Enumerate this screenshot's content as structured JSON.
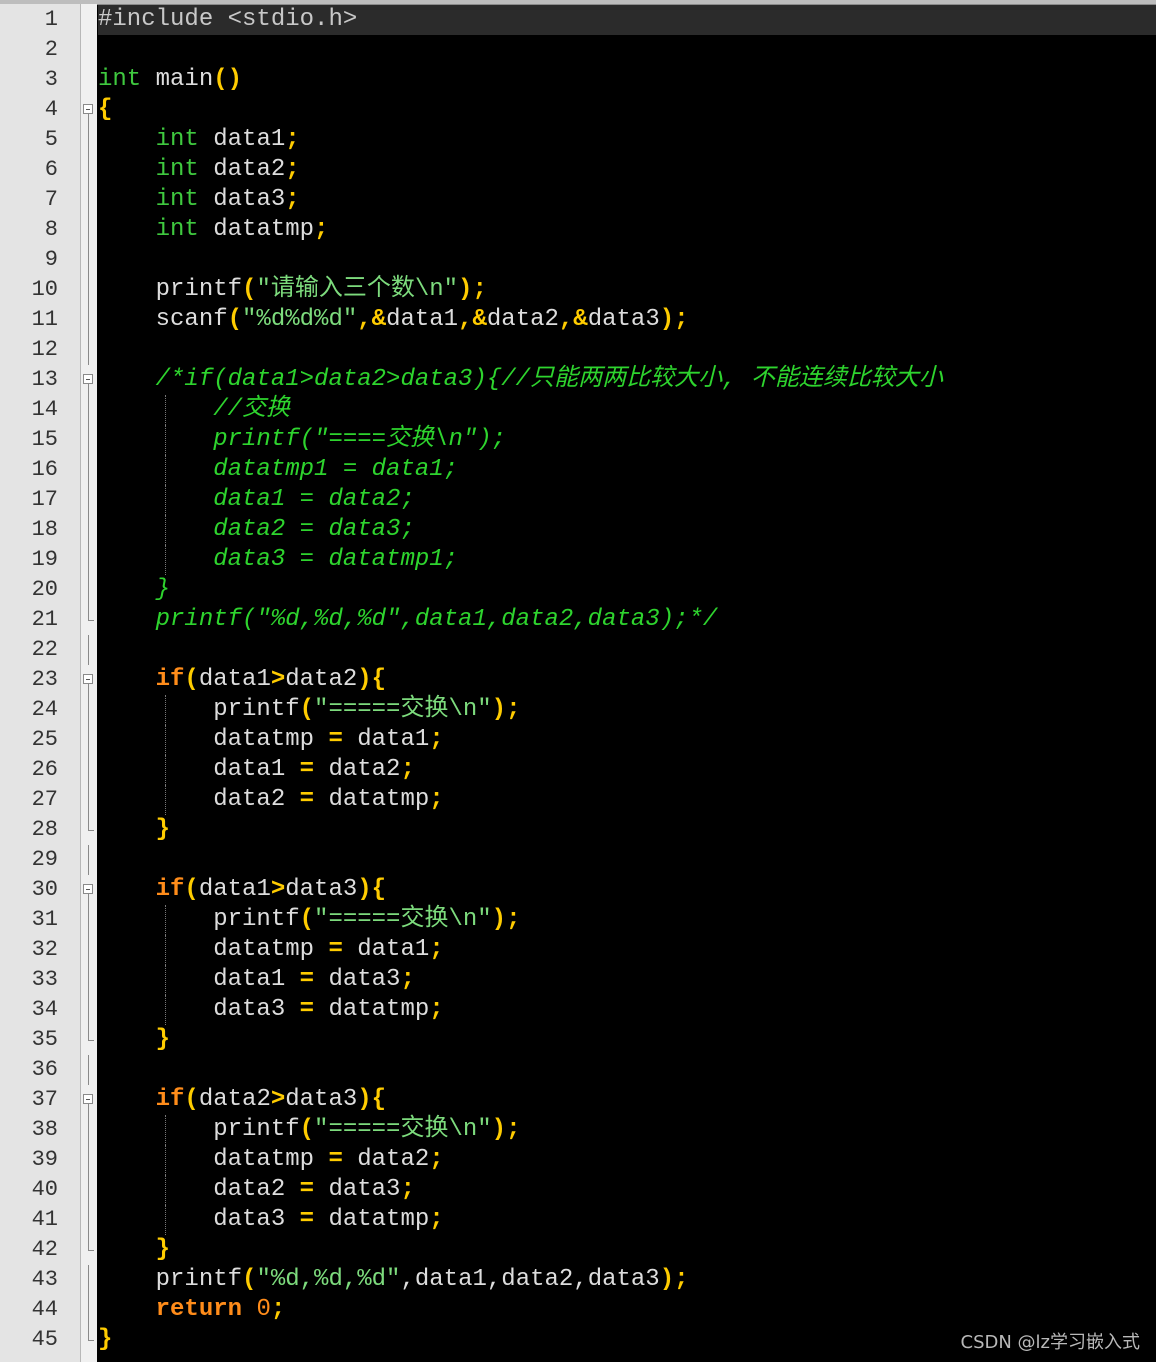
{
  "editor": {
    "watermark": "CSDN @lz学习嵌入式",
    "current_line": 1,
    "lines": [
      {
        "n": "1",
        "fold": "none",
        "tokens": [
          [
            "pre",
            "#include <stdio.h>"
          ]
        ]
      },
      {
        "n": "2",
        "fold": "none",
        "tokens": []
      },
      {
        "n": "3",
        "fold": "none",
        "tokens": [
          [
            "type",
            "int"
          ],
          [
            "plain",
            " main"
          ],
          [
            "op",
            "()"
          ]
        ]
      },
      {
        "n": "4",
        "fold": "box",
        "tokens": [
          [
            "op",
            "{"
          ]
        ]
      },
      {
        "n": "5",
        "fold": "line",
        "tokens": [
          [
            "plain",
            "    "
          ],
          [
            "type",
            "int"
          ],
          [
            "plain",
            " data1"
          ],
          [
            "op",
            ";"
          ]
        ]
      },
      {
        "n": "6",
        "fold": "line",
        "tokens": [
          [
            "plain",
            "    "
          ],
          [
            "type",
            "int"
          ],
          [
            "plain",
            " data2"
          ],
          [
            "op",
            ";"
          ]
        ]
      },
      {
        "n": "7",
        "fold": "line",
        "tokens": [
          [
            "plain",
            "    "
          ],
          [
            "type",
            "int"
          ],
          [
            "plain",
            " data3"
          ],
          [
            "op",
            ";"
          ]
        ]
      },
      {
        "n": "8",
        "fold": "line",
        "tokens": [
          [
            "plain",
            "    "
          ],
          [
            "type",
            "int"
          ],
          [
            "plain",
            " datatmp"
          ],
          [
            "op",
            ";"
          ]
        ]
      },
      {
        "n": "9",
        "fold": "line",
        "tokens": []
      },
      {
        "n": "10",
        "fold": "line",
        "tokens": [
          [
            "plain",
            "    printf"
          ],
          [
            "op",
            "("
          ],
          [
            "str",
            "\"请输入三个数\\n\""
          ],
          [
            "op",
            ");"
          ]
        ]
      },
      {
        "n": "11",
        "fold": "line",
        "tokens": [
          [
            "plain",
            "    scanf"
          ],
          [
            "op",
            "("
          ],
          [
            "str",
            "\"%d%d%d\""
          ],
          [
            "op",
            ",&"
          ],
          [
            "plain",
            "data1"
          ],
          [
            "op",
            ",&"
          ],
          [
            "plain",
            "data2"
          ],
          [
            "op",
            ",&"
          ],
          [
            "plain",
            "data3"
          ],
          [
            "op",
            ");"
          ]
        ]
      },
      {
        "n": "12",
        "fold": "line",
        "tokens": []
      },
      {
        "n": "13",
        "fold": "box",
        "tokens": [
          [
            "plain",
            "    "
          ],
          [
            "cmt",
            "/*if(data1>data2>data3){//只能两两比较大小, 不能连续比较大小"
          ]
        ]
      },
      {
        "n": "14",
        "fold": "line",
        "guide": true,
        "tokens": [
          [
            "plain",
            "        "
          ],
          [
            "cmt",
            "//交换"
          ]
        ]
      },
      {
        "n": "15",
        "fold": "line",
        "guide": true,
        "tokens": [
          [
            "plain",
            "        "
          ],
          [
            "cmt",
            "printf(\"====交换\\n\");"
          ]
        ]
      },
      {
        "n": "16",
        "fold": "line",
        "guide": true,
        "tokens": [
          [
            "plain",
            "        "
          ],
          [
            "cmt",
            "datatmp1 = data1;"
          ]
        ]
      },
      {
        "n": "17",
        "fold": "line",
        "guide": true,
        "tokens": [
          [
            "plain",
            "        "
          ],
          [
            "cmt",
            "data1 = data2;"
          ]
        ]
      },
      {
        "n": "18",
        "fold": "line",
        "guide": true,
        "tokens": [
          [
            "plain",
            "        "
          ],
          [
            "cmt",
            "data2 = data3;"
          ]
        ]
      },
      {
        "n": "19",
        "fold": "line",
        "guide": true,
        "tokens": [
          [
            "plain",
            "        "
          ],
          [
            "cmt",
            "data3 = datatmp1;"
          ]
        ]
      },
      {
        "n": "20",
        "fold": "line",
        "tokens": [
          [
            "plain",
            "    "
          ],
          [
            "cmt",
            "}"
          ]
        ]
      },
      {
        "n": "21",
        "fold": "end",
        "tokens": [
          [
            "plain",
            "    "
          ],
          [
            "cmt",
            "printf(\"%d,%d,%d\",data1,data2,data3);*/"
          ]
        ]
      },
      {
        "n": "22",
        "fold": "line",
        "tokens": []
      },
      {
        "n": "23",
        "fold": "box",
        "tokens": [
          [
            "plain",
            "    "
          ],
          [
            "kw",
            "if"
          ],
          [
            "op",
            "("
          ],
          [
            "plain",
            "data1"
          ],
          [
            "op",
            ">"
          ],
          [
            "plain",
            "data2"
          ],
          [
            "op",
            "){"
          ]
        ]
      },
      {
        "n": "24",
        "fold": "line",
        "guide": true,
        "tokens": [
          [
            "plain",
            "        printf"
          ],
          [
            "op",
            "("
          ],
          [
            "str",
            "\"=====交换\\n\""
          ],
          [
            "op",
            ");"
          ]
        ]
      },
      {
        "n": "25",
        "fold": "line",
        "guide": true,
        "tokens": [
          [
            "plain",
            "        datatmp "
          ],
          [
            "op",
            "="
          ],
          [
            "plain",
            " data1"
          ],
          [
            "op",
            ";"
          ]
        ]
      },
      {
        "n": "26",
        "fold": "line",
        "guide": true,
        "tokens": [
          [
            "plain",
            "        data1 "
          ],
          [
            "op",
            "="
          ],
          [
            "plain",
            " data2"
          ],
          [
            "op",
            ";"
          ]
        ]
      },
      {
        "n": "27",
        "fold": "line",
        "guide": true,
        "tokens": [
          [
            "plain",
            "        data2 "
          ],
          [
            "op",
            "="
          ],
          [
            "plain",
            " datatmp"
          ],
          [
            "op",
            ";"
          ]
        ]
      },
      {
        "n": "28",
        "fold": "end",
        "tokens": [
          [
            "plain",
            "    "
          ],
          [
            "op",
            "}"
          ]
        ]
      },
      {
        "n": "29",
        "fold": "line",
        "tokens": []
      },
      {
        "n": "30",
        "fold": "box",
        "tokens": [
          [
            "plain",
            "    "
          ],
          [
            "kw",
            "if"
          ],
          [
            "op",
            "("
          ],
          [
            "plain",
            "data1"
          ],
          [
            "op",
            ">"
          ],
          [
            "plain",
            "data3"
          ],
          [
            "op",
            "){"
          ]
        ]
      },
      {
        "n": "31",
        "fold": "line",
        "guide": true,
        "tokens": [
          [
            "plain",
            "        printf"
          ],
          [
            "op",
            "("
          ],
          [
            "str",
            "\"=====交换\\n\""
          ],
          [
            "op",
            ");"
          ]
        ]
      },
      {
        "n": "32",
        "fold": "line",
        "guide": true,
        "tokens": [
          [
            "plain",
            "        datatmp "
          ],
          [
            "op",
            "="
          ],
          [
            "plain",
            " data1"
          ],
          [
            "op",
            ";"
          ]
        ]
      },
      {
        "n": "33",
        "fold": "line",
        "guide": true,
        "tokens": [
          [
            "plain",
            "        data1 "
          ],
          [
            "op",
            "="
          ],
          [
            "plain",
            " data3"
          ],
          [
            "op",
            ";"
          ]
        ]
      },
      {
        "n": "34",
        "fold": "line",
        "guide": true,
        "tokens": [
          [
            "plain",
            "        data3 "
          ],
          [
            "op",
            "="
          ],
          [
            "plain",
            " datatmp"
          ],
          [
            "op",
            ";"
          ]
        ]
      },
      {
        "n": "35",
        "fold": "end",
        "tokens": [
          [
            "plain",
            "    "
          ],
          [
            "op",
            "}"
          ]
        ]
      },
      {
        "n": "36",
        "fold": "line",
        "tokens": []
      },
      {
        "n": "37",
        "fold": "box",
        "tokens": [
          [
            "plain",
            "    "
          ],
          [
            "kw",
            "if"
          ],
          [
            "op",
            "("
          ],
          [
            "plain",
            "data2"
          ],
          [
            "op",
            ">"
          ],
          [
            "plain",
            "data3"
          ],
          [
            "op",
            "){"
          ]
        ]
      },
      {
        "n": "38",
        "fold": "line",
        "guide": true,
        "tokens": [
          [
            "plain",
            "        printf"
          ],
          [
            "op",
            "("
          ],
          [
            "str",
            "\"=====交换\\n\""
          ],
          [
            "op",
            ");"
          ]
        ]
      },
      {
        "n": "39",
        "fold": "line",
        "guide": true,
        "tokens": [
          [
            "plain",
            "        datatmp "
          ],
          [
            "op",
            "="
          ],
          [
            "plain",
            " data2"
          ],
          [
            "op",
            ";"
          ]
        ]
      },
      {
        "n": "40",
        "fold": "line",
        "guide": true,
        "tokens": [
          [
            "plain",
            "        data2 "
          ],
          [
            "op",
            "="
          ],
          [
            "plain",
            " data3"
          ],
          [
            "op",
            ";"
          ]
        ]
      },
      {
        "n": "41",
        "fold": "line",
        "guide": true,
        "tokens": [
          [
            "plain",
            "        data3 "
          ],
          [
            "op",
            "="
          ],
          [
            "plain",
            " datatmp"
          ],
          [
            "op",
            ";"
          ]
        ]
      },
      {
        "n": "42",
        "fold": "end",
        "tokens": [
          [
            "plain",
            "    "
          ],
          [
            "op",
            "}"
          ]
        ]
      },
      {
        "n": "43",
        "fold": "line",
        "tokens": [
          [
            "plain",
            "    printf"
          ],
          [
            "op",
            "("
          ],
          [
            "str",
            "\"%d,%d,%d\""
          ],
          [
            "plain",
            ",data1,data2,data3"
          ],
          [
            "op",
            ");"
          ]
        ]
      },
      {
        "n": "44",
        "fold": "line",
        "tokens": [
          [
            "plain",
            "    "
          ],
          [
            "kw",
            "return"
          ],
          [
            "plain",
            " "
          ],
          [
            "num",
            "0"
          ],
          [
            "op",
            ";"
          ]
        ]
      },
      {
        "n": "45",
        "fold": "end",
        "tokens": [
          [
            "op",
            "}"
          ]
        ]
      }
    ]
  }
}
